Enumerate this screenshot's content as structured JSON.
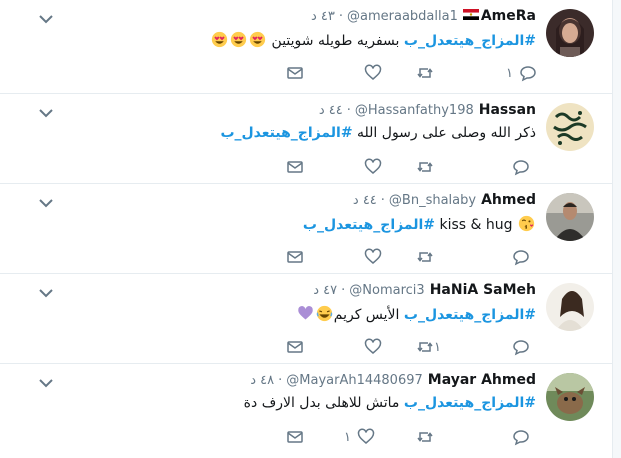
{
  "colors": {
    "hashtag": "#1b95e0",
    "meta": "#657786",
    "border": "#e6ecf0",
    "like_heart": "#e0245e"
  },
  "tweets": [
    {
      "name": "AmeRa",
      "handle": "@ameraabdalla1",
      "time": "٤٣ د",
      "has_flag": true,
      "hashtag": "#المزاج_هيتعدل_ب",
      "body": " بسفريه طويله شويتين ",
      "emoji": [
        "heart-eyes-emoji",
        "heart-eyes-emoji",
        "heart-eyes-emoji"
      ],
      "reply_count": "١",
      "retweet_count": "",
      "like_count": "",
      "avatar": "woman-selfie-avatar"
    },
    {
      "name": "Hassan",
      "handle": "@Hassanfathy198",
      "time": "٤٤ د",
      "has_flag": false,
      "hashtag": "#المزاج_هيتعدل_ب",
      "body": "ذكر الله وصلى على رسول الله  ",
      "emoji": [],
      "reply_count": "",
      "retweet_count": "",
      "like_count": "",
      "avatar": "calligraphy-avatar"
    },
    {
      "name": "Ahmed",
      "handle": "@Bn_shalaby",
      "time": "٤٤ د",
      "has_flag": false,
      "hashtag": "#المزاج_هيتعدل_ب",
      "body": " kiss & hug ",
      "emoji": [
        "kiss-emoji"
      ],
      "reply_count": "",
      "retweet_count": "",
      "like_count": "",
      "avatar": "man-photo-avatar"
    },
    {
      "name": "HaNiA SaMeh",
      "handle": "@Nomarci3",
      "time": "٤٧ د",
      "has_flag": false,
      "hashtag": "#المزاج_هيتعدل_ب",
      "body": " الأيس كريم",
      "emoji": [
        "laughing-emoji",
        "purple-heart-emoji"
      ],
      "reply_count": "",
      "retweet_count": "١",
      "like_count": "",
      "avatar": "girl-photo-avatar"
    },
    {
      "name": "Mayar Ahmed",
      "handle": "@MayarAh14480697",
      "time": "٤٨ د",
      "has_flag": false,
      "hashtag": "#المزاج_هيتعدل_ب",
      "body": " ماتش للاهلى بدل الارف دة",
      "emoji": [],
      "reply_count": "",
      "retweet_count": "",
      "like_count": "١",
      "avatar": "pet-photo-avatar"
    }
  ]
}
